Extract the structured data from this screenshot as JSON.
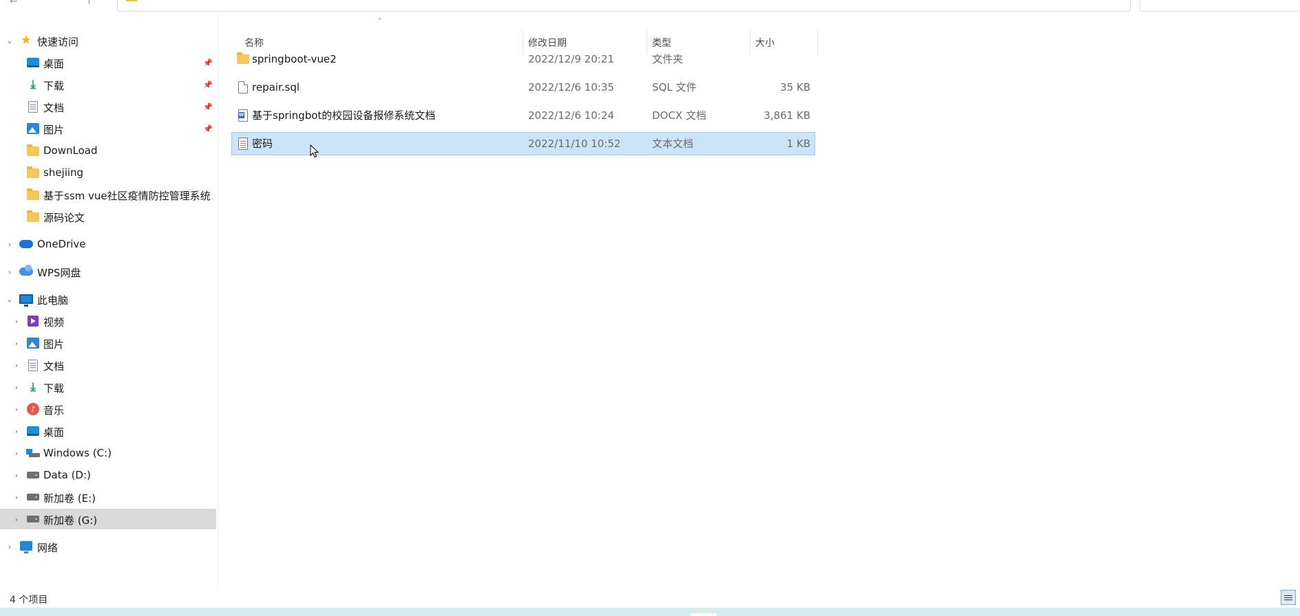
{
  "sidebar": {
    "quick_access": {
      "label": "快速访问",
      "items": [
        {
          "label": "桌面",
          "icon": "desktop-icon",
          "pinned": true
        },
        {
          "label": "下载",
          "icon": "download-icon",
          "pinned": true
        },
        {
          "label": "文档",
          "icon": "document-icon",
          "pinned": true
        },
        {
          "label": "图片",
          "icon": "pictures-icon",
          "pinned": true
        },
        {
          "label": "DownLoad",
          "icon": "folder-icon"
        },
        {
          "label": "shejiing",
          "icon": "folder-icon"
        },
        {
          "label": "基于ssm vue社区疫情防控管理系统",
          "icon": "folder-icon"
        },
        {
          "label": "源码论文",
          "icon": "folder-icon"
        }
      ]
    },
    "onedrive": {
      "label": "OneDrive"
    },
    "wps": {
      "label": "WPS网盘"
    },
    "this_pc": {
      "label": "此电脑",
      "items": [
        {
          "label": "视频",
          "icon": "video-icon"
        },
        {
          "label": "图片",
          "icon": "pictures-icon"
        },
        {
          "label": "文档",
          "icon": "document-icon"
        },
        {
          "label": "下载",
          "icon": "download-icon"
        },
        {
          "label": "音乐",
          "icon": "music-icon"
        },
        {
          "label": "桌面",
          "icon": "desktop-icon"
        },
        {
          "label": "Windows (C:)",
          "icon": "windows-drive-icon"
        },
        {
          "label": "Data (D:)",
          "icon": "drive-icon"
        },
        {
          "label": "新加卷 (E:)",
          "icon": "drive-icon"
        },
        {
          "label": "新加卷 (G:)",
          "icon": "drive-icon",
          "selected": true
        }
      ]
    },
    "network": {
      "label": "网络"
    }
  },
  "columns": {
    "name": "名称",
    "modified": "修改日期",
    "type": "类型",
    "size": "大小"
  },
  "files": [
    {
      "name": "springboot-vue2",
      "modified": "2022/12/9 20:21",
      "type": "文件夹",
      "size": "",
      "icon": "folder-icon"
    },
    {
      "name": "repair.sql",
      "modified": "2022/12/6 10:35",
      "type": "SQL 文件",
      "size": "35 KB",
      "icon": "sql-file-icon"
    },
    {
      "name": "基于springbot的校园设备报修系统文档",
      "modified": "2022/12/6 10:24",
      "type": "DOCX 文档",
      "size": "3,861 KB",
      "icon": "docx-file-icon"
    },
    {
      "name": "密码",
      "modified": "2022/11/10 10:52",
      "type": "文本文档",
      "size": "1 KB",
      "icon": "text-file-icon",
      "selected": true
    }
  ],
  "status": {
    "item_count": "4 个项目"
  },
  "colors": {
    "selection": "#cce4f7",
    "sidebar_selected": "#d9d9d9",
    "taskbar": "#d7ecef"
  }
}
